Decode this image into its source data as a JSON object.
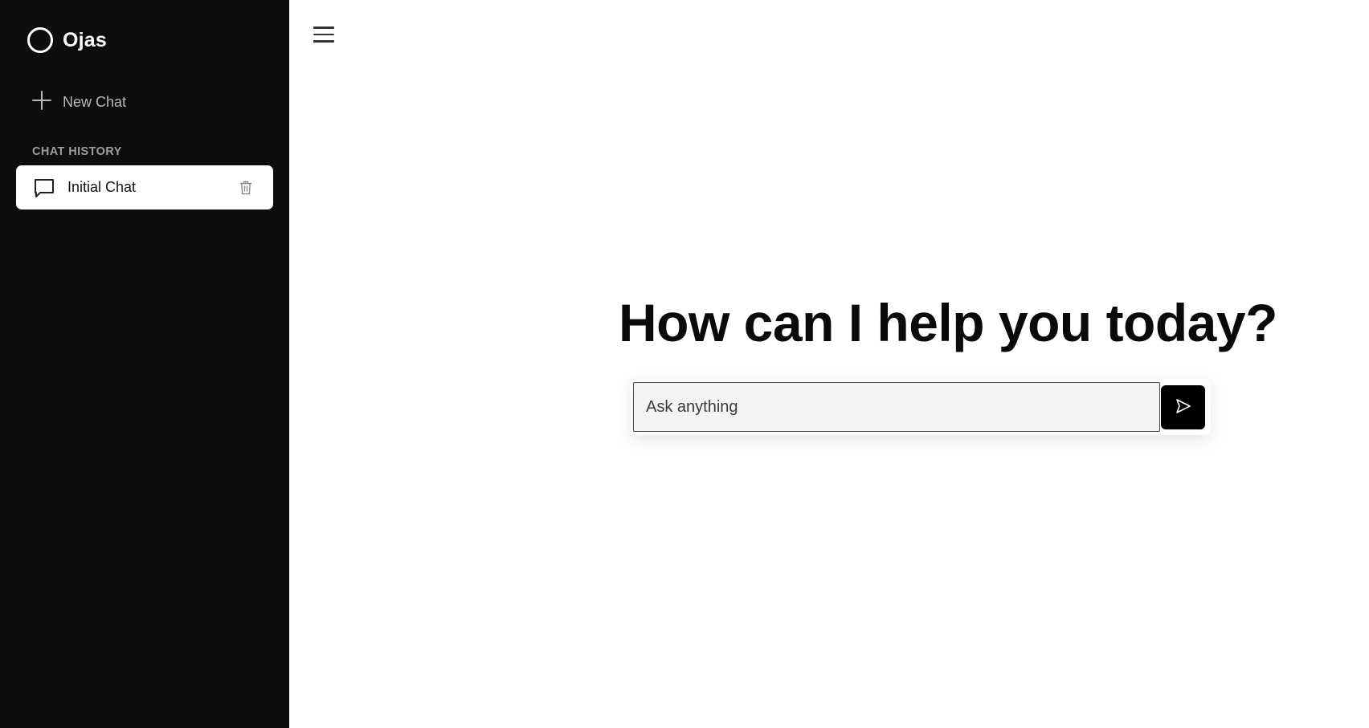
{
  "sidebar": {
    "brand_name": "Ojas",
    "new_chat_label": "New Chat",
    "history_heading": "CHAT HISTORY",
    "history_items": [
      {
        "label": "Initial Chat",
        "active": true
      }
    ]
  },
  "main": {
    "hero_title": "How can I help you today?",
    "composer": {
      "placeholder": "Ask anything",
      "value": ""
    }
  },
  "colors": {
    "sidebar_bg": "#0d0d0d",
    "accent": "#000000",
    "input_bg": "#f3f4f6"
  },
  "icons": {
    "brand": "circle-logo-icon",
    "new_chat": "plus-icon",
    "history_item": "chat-bubble-icon",
    "delete": "trash-icon",
    "menu": "hamburger-menu-icon",
    "send": "send-arrow-icon"
  }
}
